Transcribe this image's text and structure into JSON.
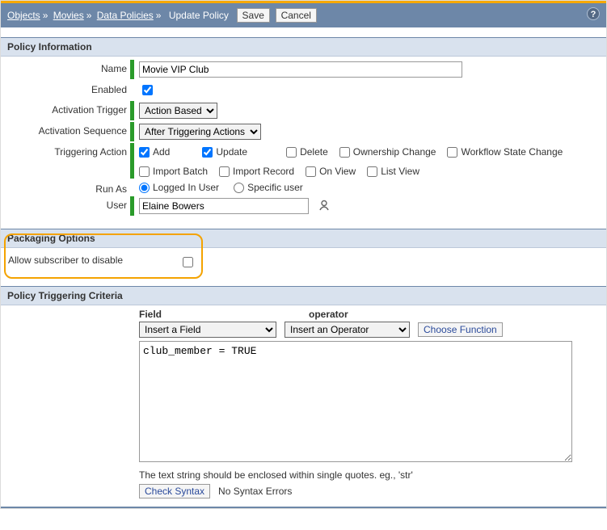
{
  "header": {
    "breadcrumb": [
      "Objects",
      "Movies",
      "Data Policies",
      "Update Policy"
    ],
    "save_label": "Save",
    "cancel_label": "Cancel"
  },
  "policy_info": {
    "section_title": "Policy Information",
    "name_label": "Name",
    "name_value": "Movie VIP Club",
    "enabled_label": "Enabled",
    "enabled_checked": true,
    "activation_trigger_label": "Activation Trigger",
    "activation_trigger_value": "Action Based",
    "activation_sequence_label": "Activation Sequence",
    "activation_sequence_value": "After Triggering Actions",
    "triggering_action_label": "Triggering Action",
    "actions": [
      {
        "label": "Add",
        "checked": true
      },
      {
        "label": "Update",
        "checked": true
      },
      {
        "label": "Delete",
        "checked": false
      },
      {
        "label": "Ownership Change",
        "checked": false
      },
      {
        "label": "Workflow State Change",
        "checked": false
      },
      {
        "label": "Import Batch",
        "checked": false
      },
      {
        "label": "Import Record",
        "checked": false
      },
      {
        "label": "On View",
        "checked": false
      },
      {
        "label": "List View",
        "checked": false
      }
    ],
    "run_as_label": "Run As",
    "run_as_options": [
      "Logged In User",
      "Specific user"
    ],
    "run_as_selected": 0,
    "user_label": "User",
    "user_value": "Elaine Bowers"
  },
  "packaging": {
    "section_title": "Packaging Options",
    "allow_label": "Allow subscriber to disable",
    "allow_checked": false
  },
  "criteria": {
    "section_title": "Policy Triggering Criteria",
    "field_label": "Field",
    "field_select_value": "Insert a Field",
    "operator_label": "operator",
    "operator_select_value": "Insert an Operator",
    "choose_function_label": "Choose Function",
    "expression_value": "club_member = TRUE",
    "hint_text": "The text string should be enclosed within single quotes. eg., 'str'",
    "check_syntax_label": "Check Syntax",
    "syntax_result": "No Syntax Errors"
  }
}
